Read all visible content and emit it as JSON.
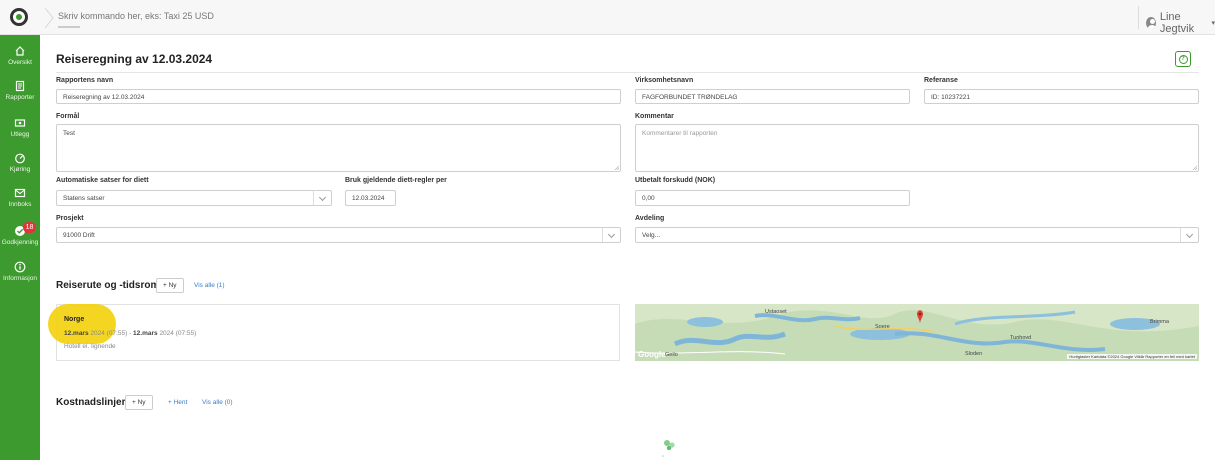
{
  "topbar": {
    "command_placeholder": "Skriv kommando her, eks: Taxi 25 USD",
    "user_name": "Line Jegtvik"
  },
  "sidebar": {
    "items": [
      {
        "label": "Oversikt",
        "icon": "home-icon"
      },
      {
        "label": "Rapporter",
        "icon": "reports-icon"
      },
      {
        "label": "Utlegg",
        "icon": "expenses-icon"
      },
      {
        "label": "Kjøring",
        "icon": "driving-icon"
      },
      {
        "label": "Innboks",
        "icon": "inbox-icon"
      },
      {
        "label": "Godkjenning",
        "icon": "approval-icon",
        "badge": "18"
      },
      {
        "label": "Informasjon",
        "icon": "info-icon"
      }
    ]
  },
  "page": {
    "title": "Reiseregning av 12.03.2024"
  },
  "form": {
    "report_name_label": "Rapportens navn",
    "report_name_value": "Reiseregning av 12.03.2024",
    "company_label": "Virksomhetsnavn",
    "company_value": "FAGFORBUNDET TRØNDELAG",
    "reference_label": "Referanse",
    "reference_value": "ID: 10237221",
    "purpose_label": "Formål",
    "purpose_value": "Test",
    "comment_label": "Kommentar",
    "comment_placeholder": "Kommentarer til rapporten",
    "auto_rates_label": "Automatiske satser for diett",
    "auto_rates_value": "Statens satser",
    "diet_rules_label": "Bruk gjeldende diett-regler per",
    "diet_rules_value": "12.03.2024",
    "advance_label": "Utbetalt forskudd (NOK)",
    "advance_value": "0,00",
    "project_label": "Prosjekt",
    "project_value": "91000 Drift",
    "department_label": "Avdeling",
    "department_value": "Velg..."
  },
  "trip_section": {
    "title": "Reiserute og -tidsrom",
    "new_label": "Ny",
    "show_all": "Vis alle (1)",
    "trip": {
      "destination": "Norge",
      "start_date": "12.mars",
      "start_rest": "2024 (07:55)",
      "separator": " - ",
      "end_date": "12.mars",
      "end_rest": "2024 (07:55)",
      "accommodation": "Hotell el. lignende"
    },
    "map": {
      "labels": [
        "Ustaoset",
        "Soere",
        "Tunhovd",
        "Brimma",
        "Geilo",
        "Sloden"
      ],
      "google": "Google",
      "attribution": "Hurtigtaster   Kartdata ©2024 Google   Vilkår   Rapporter en feil med kartet"
    }
  },
  "cost_section": {
    "title": "Kostnadslinjer",
    "new_label": "Ny",
    "fetch_label": "Hent",
    "show_all": "Vis alle (0)"
  },
  "colors": {
    "brand_green": "#3d9a2e",
    "highlight_yellow": "#f3d20f",
    "link_blue": "#3b7dc4",
    "badge_red": "#e2343b"
  }
}
